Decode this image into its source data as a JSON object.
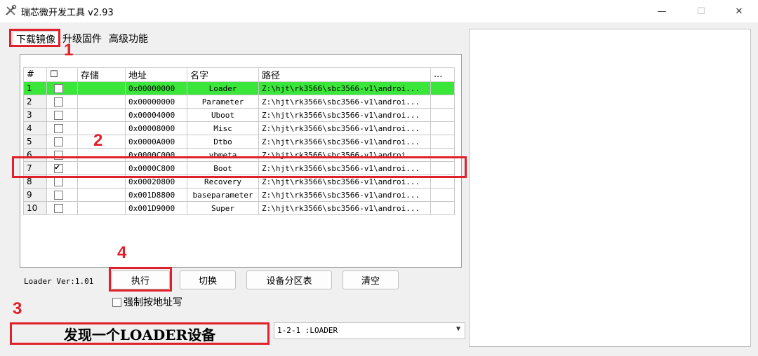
{
  "window": {
    "title": "瑞芯微开发工具 v2.93",
    "min_icon": "—",
    "max_icon": "☐",
    "close_icon": "✕"
  },
  "tabs": [
    {
      "label": "下载镜像",
      "active": true
    },
    {
      "label": "升级固件",
      "active": false
    },
    {
      "label": "高级功能",
      "active": false
    }
  ],
  "grid": {
    "headers": [
      "#",
      "☐",
      "存储",
      "地址",
      "名字",
      "路径",
      "..."
    ],
    "rows": [
      {
        "index": "1",
        "checked": false,
        "address": "0x00000000",
        "name": "Loader",
        "path": "Z:\\hjt\\rk3566\\sbc3566-v1\\androi...",
        "selected": true
      },
      {
        "index": "2",
        "checked": false,
        "address": "0x00000000",
        "name": "Parameter",
        "path": "Z:\\hjt\\rk3566\\sbc3566-v1\\androi...",
        "selected": false
      },
      {
        "index": "3",
        "checked": false,
        "address": "0x00004000",
        "name": "Uboot",
        "path": "Z:\\hjt\\rk3566\\sbc3566-v1\\androi...",
        "selected": false
      },
      {
        "index": "4",
        "checked": false,
        "address": "0x00008000",
        "name": "Misc",
        "path": "Z:\\hjt\\rk3566\\sbc3566-v1\\androi...",
        "selected": false
      },
      {
        "index": "5",
        "checked": false,
        "address": "0x0000A000",
        "name": "Dtbo",
        "path": "Z:\\hjt\\rk3566\\sbc3566-v1\\androi...",
        "selected": false
      },
      {
        "index": "6",
        "checked": false,
        "address": "0x0000C000",
        "name": "vbmeta",
        "path": "Z:\\hjt\\rk3566\\sbc3566-v1\\androi...",
        "selected": false
      },
      {
        "index": "7",
        "checked": true,
        "address": "0x0000C800",
        "name": "Boot",
        "path": "Z:\\hjt\\rk3566\\sbc3566-v1\\androi...",
        "selected": false
      },
      {
        "index": "8",
        "checked": false,
        "address": "0x00020800",
        "name": "Recovery",
        "path": "Z:\\hjt\\rk3566\\sbc3566-v1\\androi...",
        "selected": false
      },
      {
        "index": "9",
        "checked": false,
        "address": "0x001D8800",
        "name": "baseparameter",
        "path": "Z:\\hjt\\rk3566\\sbc3566-v1\\androi...",
        "selected": false
      },
      {
        "index": "10",
        "checked": false,
        "address": "0x001D9000",
        "name": "Super",
        "path": "Z:\\hjt\\rk3566\\sbc3566-v1\\androi...",
        "selected": false
      }
    ]
  },
  "loader_version": "Loader Ver:1.01",
  "buttons": {
    "run": "执行",
    "switch": "切换",
    "partition_table": "设备分区表",
    "clear": "清空"
  },
  "force_address_label": "强制按地址写",
  "status_text": "发现一个LOADER设备",
  "device_select_value": "1-2-1 :LOADER",
  "annotations": [
    "1",
    "2",
    "3",
    "4"
  ],
  "colors": {
    "selected_row": "#39e639",
    "annotation_red": "#e0202a"
  }
}
